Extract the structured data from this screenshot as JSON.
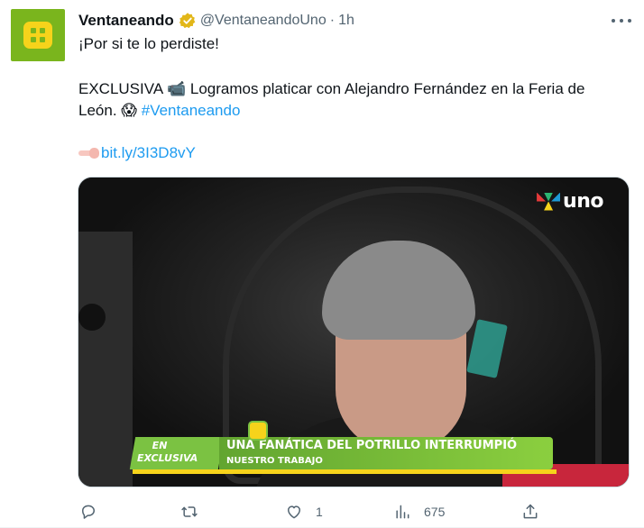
{
  "account": {
    "name": "Ventaneando",
    "handle": "@VentaneandoUno",
    "separator": "·",
    "time": "1h",
    "verified": true
  },
  "tweet": {
    "line1": "¡Por si te lo perdiste!",
    "line2_prefix": "EXCLUSIVA",
    "line2_emoji": "📹",
    "line2_text": "Logramos platicar con Alejandro Fernández en la Feria de",
    "line3_text": "León.",
    "line3_emoji": "😱",
    "hashtag": "#Ventaneando",
    "link": "bit.ly/3I3D8vY"
  },
  "media": {
    "channel_logo": "uno",
    "banner_tag_top": "EN",
    "banner_tag_bottom": "EXCLUSIVA",
    "banner_headline": "UNA FANÁTICA DEL POTRILLO INTERRUMPIÓ",
    "banner_subline": "NUESTRO TRABAJO"
  },
  "actions": {
    "reply": {
      "icon": "reply-icon",
      "count": ""
    },
    "retweet": {
      "icon": "retweet-icon",
      "count": ""
    },
    "like": {
      "icon": "heart-icon",
      "count": "1"
    },
    "views": {
      "icon": "views-icon",
      "count": "675"
    },
    "share": {
      "icon": "share-icon",
      "count": ""
    }
  },
  "colors": {
    "link": "#1d9bf0",
    "secondary_text": "#536471",
    "avatar_green": "#7ab51d",
    "avatar_yellow": "#f6d31b"
  }
}
